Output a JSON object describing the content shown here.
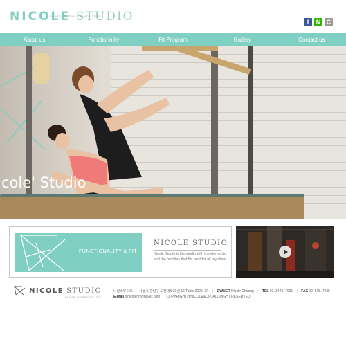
{
  "header": {
    "logo_main": "NICOLE",
    "logo_studio": "STUDIO",
    "logo_tagline": "PILATES / POWER PLATE / TRX",
    "social": [
      {
        "icon": "facebook-icon",
        "glyph": "f",
        "color": "#3b5998"
      },
      {
        "icon": "naver-icon",
        "glyph": "N",
        "color": "#2db400"
      },
      {
        "icon": "cafe-icon",
        "glyph": "C",
        "color": "#9a9a9a"
      }
    ]
  },
  "nav": {
    "items": [
      "About us",
      "Functionality",
      "Fit Program",
      "Gallery",
      "Contact us"
    ]
  },
  "hero": {
    "overlay_text": "cole' Studio"
  },
  "feature": {
    "label": "FUNCTIONALITY & FIT"
  },
  "studio": {
    "title": "NICOLE STUDIO",
    "description": "Nicole Studio is the studio with the elements and the facilities that fits best for all my client"
  },
  "footer": {
    "logo_main": "NICOLE",
    "logo_studio": "STUDIO",
    "logo_tagline": "PILATES / POWER PLATE / TRX",
    "company": "니콜스튜디오",
    "address": "서울시 강남구 도산대로39길 16 Table 2025, 2F",
    "owner_label": "OWNER",
    "owner": "Nicole Cheong",
    "tel_label": "TEL",
    "tel": "02. 3443. 7001",
    "fax_label": "FAX",
    "fax": "02. 515. 7535",
    "email_label": "E-mail",
    "email": "fitnicolehn@naver.com",
    "copyright": "COPYRIGHT@NICOLE&CO. ALL RIGHT RESERVED."
  },
  "colors": {
    "accent": "#7fcfc2",
    "text_gray": "#777777"
  }
}
